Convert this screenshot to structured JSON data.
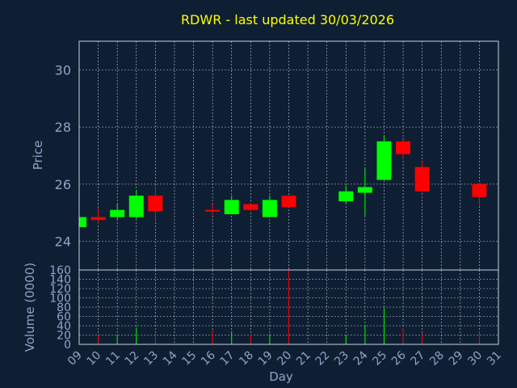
{
  "chart_data": {
    "type": "candlestick",
    "title": "RDWR - last updated 30/03/2026",
    "xlabel": "Day",
    "price_panel": {
      "ylabel": "Price",
      "ylim": [
        23,
        31
      ],
      "yticks": [
        24,
        26,
        28,
        30
      ]
    },
    "volume_panel": {
      "ylabel": "Volume (0000)",
      "ylim": [
        0,
        160
      ],
      "yticks": [
        0,
        20,
        40,
        60,
        80,
        100,
        120,
        140,
        160
      ]
    },
    "x_ticks": [
      "09",
      "10",
      "11",
      "12",
      "13",
      "14",
      "15",
      "16",
      "17",
      "18",
      "19",
      "20",
      "21",
      "22",
      "23",
      "24",
      "25",
      "26",
      "27",
      "28",
      "29",
      "30",
      "31"
    ],
    "colors": {
      "up": "#00ff00",
      "down": "#ff0000",
      "background": "#0e1f33",
      "title": "#ffff00",
      "axis_text": "#8fa4c7",
      "grid": "#c8d0dc"
    },
    "candles": [
      {
        "day": "09",
        "open": 24.5,
        "high": 24.85,
        "low": 24.5,
        "close": 24.85,
        "volume": 0
      },
      {
        "day": "10",
        "open": 24.85,
        "high": 25.15,
        "low": 24.6,
        "close": 24.75,
        "volume": 20
      },
      {
        "day": "11",
        "open": 24.85,
        "high": 25.3,
        "low": 24.75,
        "close": 25.1,
        "volume": 21
      },
      {
        "day": "12",
        "open": 24.85,
        "high": 25.8,
        "low": 24.8,
        "close": 25.6,
        "volume": 36
      },
      {
        "day": "13",
        "open": 25.6,
        "high": 25.95,
        "low": 24.75,
        "close": 25.05,
        "volume": 23
      },
      {
        "day": "16",
        "open": 25.1,
        "high": 25.3,
        "low": 24.9,
        "close": 25.05,
        "volume": 30
      },
      {
        "day": "17",
        "open": 24.95,
        "high": 25.6,
        "low": 24.95,
        "close": 25.45,
        "volume": 28
      },
      {
        "day": "18",
        "open": 25.3,
        "high": 25.35,
        "low": 25.05,
        "close": 25.1,
        "volume": 21
      },
      {
        "day": "19",
        "open": 24.85,
        "high": 25.6,
        "low": 24.85,
        "close": 25.45,
        "volume": 22
      },
      {
        "day": "20",
        "open": 25.6,
        "high": 25.6,
        "low": 25.2,
        "close": 25.2,
        "volume": 160
      },
      {
        "day": "23",
        "open": 25.4,
        "high": 25.95,
        "low": 25.3,
        "close": 25.75,
        "volume": 20
      },
      {
        "day": "24",
        "open": 25.7,
        "high": 26.55,
        "low": 24.9,
        "close": 25.9,
        "volume": 42
      },
      {
        "day": "25",
        "open": 26.15,
        "high": 27.7,
        "low": 26.15,
        "close": 27.5,
        "volume": 78
      },
      {
        "day": "26",
        "open": 27.5,
        "high": 27.55,
        "low": 26.85,
        "close": 27.05,
        "volume": 36
      },
      {
        "day": "27",
        "open": 26.6,
        "high": 26.8,
        "low": 25.7,
        "close": 25.75,
        "volume": 24
      },
      {
        "day": "30",
        "open": 26.0,
        "high": 26.0,
        "low": 25.25,
        "close": 25.55,
        "volume": 27
      }
    ]
  }
}
